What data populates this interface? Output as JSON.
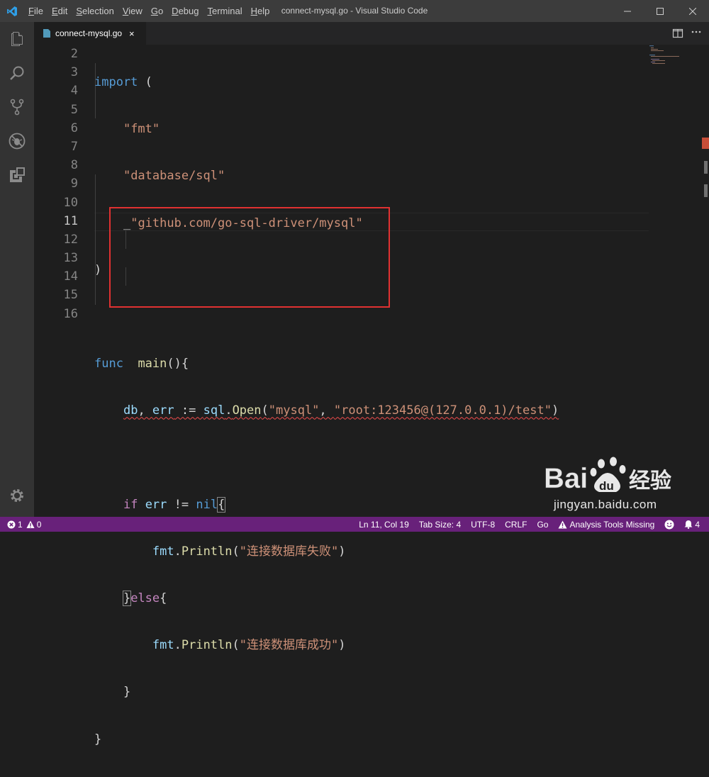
{
  "window": {
    "title": "connect-mysql.go - Visual Studio Code"
  },
  "menu": [
    {
      "label": "File",
      "mnemonic": "F",
      "rest": "ile"
    },
    {
      "label": "Edit",
      "mnemonic": "E",
      "rest": "dit"
    },
    {
      "label": "Selection",
      "mnemonic": "S",
      "rest": "election"
    },
    {
      "label": "View",
      "mnemonic": "V",
      "rest": "iew"
    },
    {
      "label": "Go",
      "mnemonic": "G",
      "rest": "o"
    },
    {
      "label": "Debug",
      "mnemonic": "D",
      "rest": "ebug"
    },
    {
      "label": "Terminal",
      "mnemonic": "T",
      "rest": "erminal"
    },
    {
      "label": "Help",
      "mnemonic": "H",
      "rest": "elp"
    }
  ],
  "tab": {
    "label": "connect-mysql.go",
    "close": "×"
  },
  "editor": {
    "line_numbers": [
      "2",
      "3",
      "4",
      "5",
      "6",
      "7",
      "8",
      "9",
      "10",
      "11",
      "12",
      "13",
      "14",
      "15",
      "16"
    ],
    "active_line": "11"
  },
  "code": {
    "l2_kw": "import",
    "l2_rest": " (",
    "l3": "\"fmt\"",
    "l4": "\"database/sql\"",
    "l5_prefix": "_",
    "l5_str": "\"github.com/go-sql-driver/mysql\"",
    "l6": ")",
    "l8_kw": "func",
    "l8_fn": "main",
    "l8_rest": "(){",
    "l9_var1": "db",
    "l9_sep": ", ",
    "l9_var2": "err",
    "l9_op": " := ",
    "l9_pkg": "sql",
    "l9_dot": ".",
    "l9_fn": "Open",
    "l9_open": "(",
    "l9_s1": "\"mysql\"",
    "l9_comma": ", ",
    "l9_s2": "\"root:123456@(127.0.0.1)/test\"",
    "l9_close": ")",
    "l11_kw": "if",
    "l11_var": "err",
    "l11_op": " != ",
    "l11_nil": "nil",
    "l11_brace": "{",
    "l12_pkg": "fmt",
    "l12_dot": ".",
    "l12_fn": "Println",
    "l12_open": "(",
    "l12_str": "\"连接数据库失败\"",
    "l12_close": ")",
    "l13_brace": "}",
    "l13_kw": "else",
    "l13_open": "{",
    "l14_pkg": "fmt",
    "l14_dot": ".",
    "l14_fn": "Println",
    "l14_open": "(",
    "l14_str": "\"连接数据库成功\"",
    "l14_close": ")",
    "l15": "}",
    "l16": "}"
  },
  "watermark": {
    "url": "jingyan.baidu.com",
    "brand": "Bai",
    "paw": "du",
    "cn": "经验"
  },
  "status": {
    "errors": "1",
    "warnings": "0",
    "position": "Ln 11, Col 19",
    "tab_size": "Tab Size: 4",
    "encoding": "UTF-8",
    "eol": "CRLF",
    "language": "Go",
    "analysis": "Analysis Tools Missing",
    "notifications": "4"
  },
  "colors": {
    "statusbar": "#68217a",
    "titlebar": "#3c3c3c",
    "activitybar": "#333333",
    "editor_bg": "#1e1e1e",
    "annotation": "#e03131"
  },
  "icons": [
    "vscode-logo-icon",
    "explorer-icon",
    "search-icon",
    "source-control-icon",
    "debug-icon",
    "extensions-icon",
    "settings-gear-icon",
    "go-file-icon",
    "split-editor-icon",
    "more-actions-icon",
    "minimize-icon",
    "maximize-icon",
    "close-window-icon",
    "error-icon",
    "warning-icon",
    "warning-triangle-icon",
    "smiley-feedback-icon",
    "bell-icon"
  ]
}
